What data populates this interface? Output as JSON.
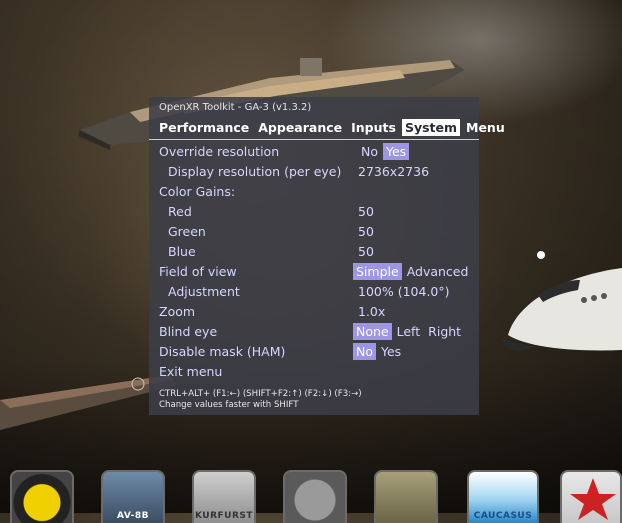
{
  "overlay": {
    "title": "OpenXR Toolkit - GA-3 (v1.3.2)",
    "tabs": [
      {
        "label": "Performance",
        "active": false
      },
      {
        "label": "Appearance",
        "active": false
      },
      {
        "label": "Inputs",
        "active": false
      },
      {
        "label": "System",
        "active": true
      },
      {
        "label": "Menu",
        "active": false
      }
    ],
    "settings": {
      "override_resolution": {
        "label": "Override resolution",
        "options": [
          "No",
          "Yes"
        ],
        "selected": "Yes"
      },
      "display_resolution": {
        "label": "Display resolution (per eye)",
        "value": "2736x2736"
      },
      "color_gains": {
        "label": "Color Gains:"
      },
      "red": {
        "label": "Red",
        "value": "50"
      },
      "green": {
        "label": "Green",
        "value": "50"
      },
      "blue": {
        "label": "Blue",
        "value": "50"
      },
      "field_of_view": {
        "label": "Field of view",
        "options": [
          "Simple",
          "Advanced"
        ],
        "selected": "Simple"
      },
      "adjustment": {
        "label": "Adjustment",
        "value": "100% (104.0°)"
      },
      "zoom": {
        "label": "Zoom",
        "value": "1.0x"
      },
      "blind_eye": {
        "label": "Blind eye",
        "options": [
          "None",
          "Left",
          "Right"
        ],
        "selected": "None"
      },
      "disable_mask": {
        "label": "Disable mask (HAM)",
        "options": [
          "No",
          "Yes"
        ],
        "selected": "No"
      },
      "exit_menu": {
        "label": "Exit menu"
      }
    },
    "footer": {
      "shortcuts": "CTRL+ALT+ (F1:←) (SHIFT+F2:↑) (F2:↓) (F3:→)",
      "hint": "Change values faster with SHIFT"
    }
  },
  "taskbar": {
    "icons": [
      {
        "name": "squadron-emblem",
        "caption": ""
      },
      {
        "name": "av8b-harrier",
        "caption": "AV-8B"
      },
      {
        "name": "kurfurst",
        "caption": "KURFURST"
      },
      {
        "name": "f-104",
        "caption": ""
      },
      {
        "name": "tank",
        "caption": ""
      },
      {
        "name": "caucasus",
        "caption": "CAUCASUS"
      },
      {
        "name": "red-star",
        "caption": ""
      }
    ]
  },
  "colors": {
    "panel_bg": "#3c3e48",
    "label_text": "#d6d6ff",
    "selected_option_bg": "#9f95e6",
    "active_tab_bg": "#ffffff"
  }
}
